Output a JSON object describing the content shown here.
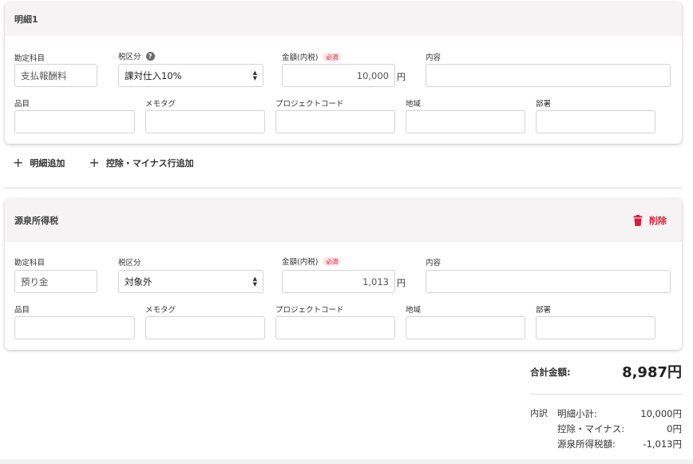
{
  "detail1": {
    "title": "明細1",
    "account": {
      "label": "勘定科目",
      "value": "支払報酬料"
    },
    "tax": {
      "label": "税区分",
      "help_icon": "?",
      "value": "課対仕入10%"
    },
    "amount": {
      "label": "金額(内税)",
      "required": "必須",
      "value": "10,000",
      "unit": "円"
    },
    "content": {
      "label": "内容",
      "value": ""
    },
    "item": {
      "label": "品目",
      "value": ""
    },
    "memo": {
      "label": "メモタグ",
      "value": ""
    },
    "project": {
      "label": "プロジェクトコード",
      "value": ""
    },
    "region": {
      "label": "地域",
      "value": ""
    },
    "department": {
      "label": "部署",
      "value": ""
    }
  },
  "actions": {
    "add_detail": "明細追加",
    "add_deduction": "控除・マイナス行追加"
  },
  "withholding": {
    "title": "源泉所得税",
    "delete_label": "削除",
    "account": {
      "label": "勘定科目",
      "value": "預り金"
    },
    "tax": {
      "label": "税区分",
      "value": "対象外"
    },
    "amount": {
      "label": "金額(内税)",
      "required": "必須",
      "value": "1,013",
      "unit": "円"
    },
    "content": {
      "label": "内容",
      "value": ""
    },
    "item": {
      "label": "品目",
      "value": ""
    },
    "memo": {
      "label": "メモタグ",
      "value": ""
    },
    "project": {
      "label": "プロジェクトコード",
      "value": ""
    },
    "region": {
      "label": "地域",
      "value": ""
    },
    "department": {
      "label": "部署",
      "value": ""
    }
  },
  "summary": {
    "total_label": "合計金額:",
    "total_value": "8,987円",
    "breakdown_title": "内訳",
    "rows": [
      {
        "label": "明細小計:",
        "value": "10,000円"
      },
      {
        "label": "控除・マイナス:",
        "value": "0円"
      },
      {
        "label": "源泉所得税額:",
        "value": "-1,013円"
      }
    ]
  },
  "colors": {
    "accent_red": "#d3203b",
    "header_bg": "#f5f3f3"
  }
}
